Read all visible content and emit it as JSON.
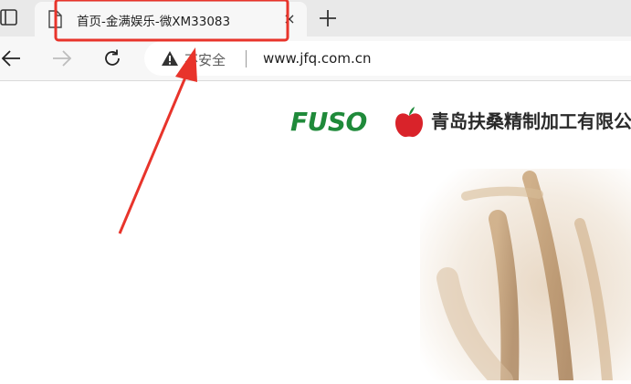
{
  "browser": {
    "tab": {
      "title": "首页-金满娱乐-微XM33083",
      "close_glyph": "×",
      "icon": "page-icon"
    },
    "tab_actions_icon": "tab-actions-icon",
    "new_tab_icon": "plus-icon",
    "toolbar": {
      "back_icon": "back-arrow-icon",
      "forward_icon": "forward-arrow-icon",
      "reload_icon": "reload-icon"
    },
    "address_bar": {
      "security_icon": "warning-triangle-icon",
      "security_text": "不安全",
      "url": "www.jfq.com.cn"
    }
  },
  "page": {
    "logo_text": "FUSO",
    "company_name": "青岛扶桑精制加工有限公司",
    "colors": {
      "logo_green": "#1f8a3a",
      "apple_red": "#d9232a"
    }
  },
  "annotation": {
    "color": "#e8342b",
    "type": "highlight-box-with-arrow"
  }
}
